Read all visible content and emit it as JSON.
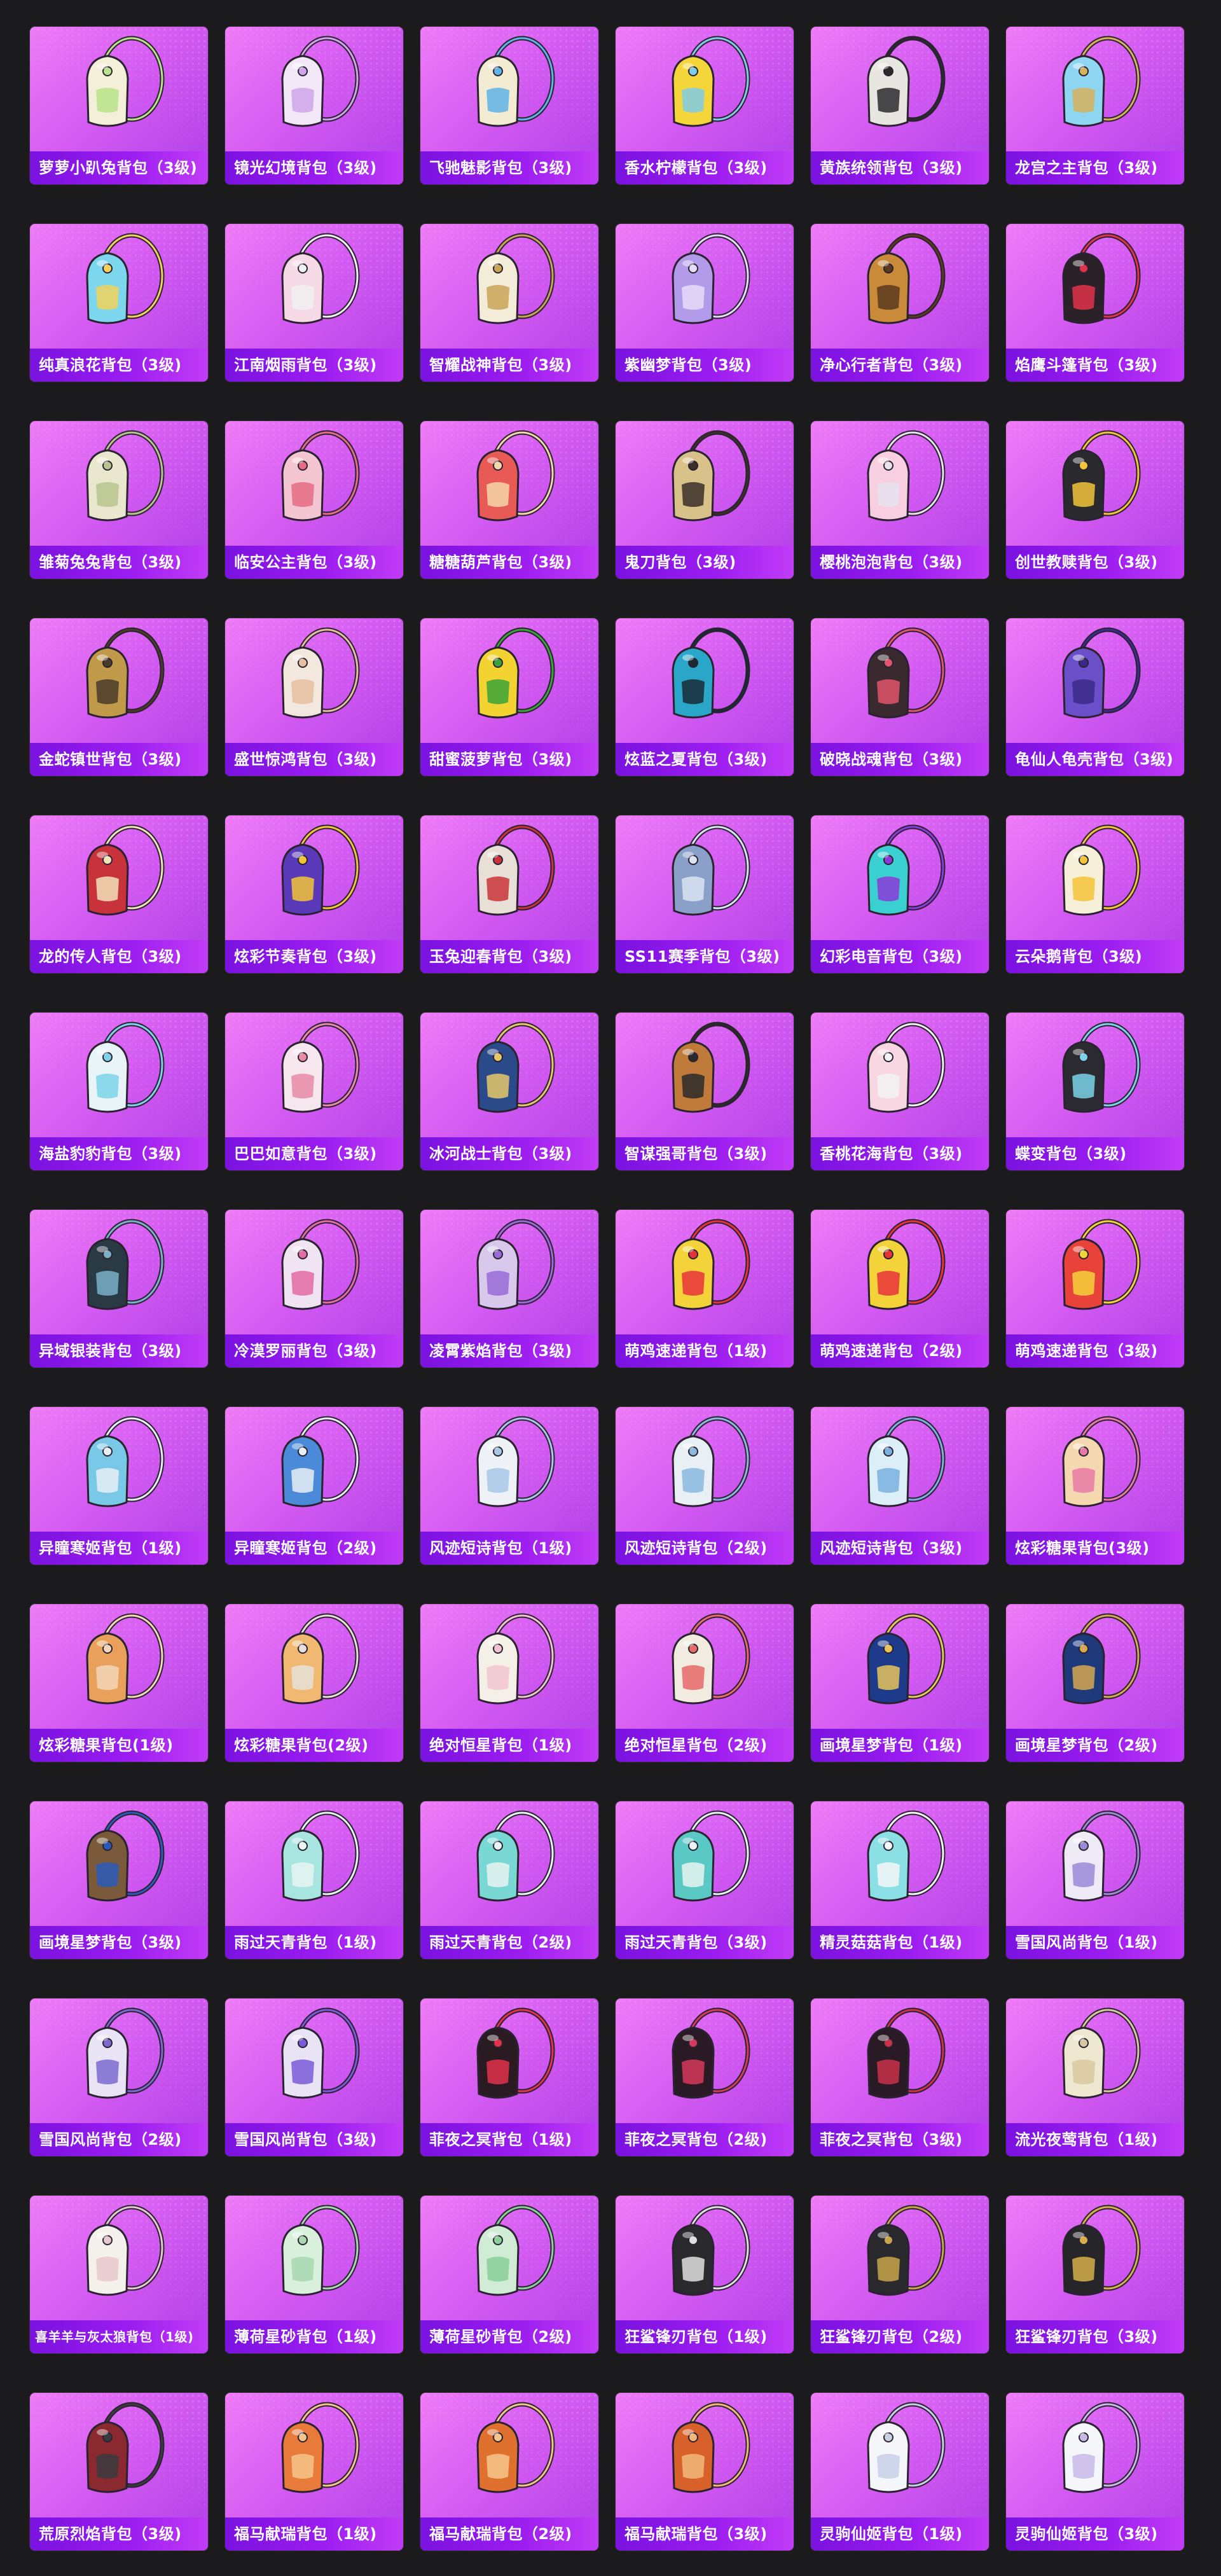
{
  "items": [
    {
      "label": "萝萝小趴兔背包（3级)",
      "color": "#f4efd8",
      "accent": "#b9e28a",
      "icon": "bunny-backpack-icon"
    },
    {
      "label": "镜光幻境背包（3级)",
      "color": "#f2e7f6",
      "accent": "#cfa4ea",
      "icon": "butterfly-backpack-icon"
    },
    {
      "label": "飞驰魅影背包（3级)",
      "color": "#f3ecd2",
      "accent": "#5fb3e8",
      "icon": "helmet-backpack-icon"
    },
    {
      "label": "香水柠檬背包（3级)",
      "color": "#f5d63a",
      "accent": "#7fcbe8",
      "icon": "lemon-backpack-icon"
    },
    {
      "label": "黄族统领背包（3级)",
      "color": "#e8e6e0",
      "accent": "#2a2a2e",
      "icon": "armor-backpack-icon"
    },
    {
      "label": "龙宫之主背包（3级)",
      "color": "#8fd6f2",
      "accent": "#d6b25a",
      "icon": "dragon-backpack-icon"
    },
    {
      "label": "纯真浪花背包（3级)",
      "color": "#7cd7ee",
      "accent": "#f2d25a",
      "icon": "wave-backpack-icon"
    },
    {
      "label": "江南烟雨背包（3级)",
      "color": "#f6dbe6",
      "accent": "#f1f1f1",
      "icon": "flower-backpack-icon"
    },
    {
      "label": "智耀战神背包（3级)",
      "color": "#f3ecd8",
      "accent": "#c8a457",
      "icon": "wing-backpack-icon"
    },
    {
      "label": "紫幽梦背包（3级)",
      "color": "#b29be8",
      "accent": "#e6dcfa",
      "icon": "dream-backpack-icon"
    },
    {
      "label": "净心行者背包（3级)",
      "color": "#c98a3a",
      "accent": "#5a3a1e",
      "icon": "gourd-backpack-icon"
    },
    {
      "label": "焰鹰斗篷背包（3级)",
      "color": "#2a2228",
      "accent": "#e0334a",
      "icon": "hawk-backpack-icon"
    },
    {
      "label": "雏菊兔兔背包（3级)",
      "color": "#e9e8cf",
      "accent": "#b7c48e",
      "icon": "daisy-backpack-icon"
    },
    {
      "label": "临安公主背包（3级)",
      "color": "#f4c6d2",
      "accent": "#e46b86",
      "icon": "princess-backpack-icon"
    },
    {
      "label": "糖糖葫芦背包（3级)",
      "color": "#e85a55",
      "accent": "#f4d7a8",
      "icon": "candy-backpack-icon"
    },
    {
      "label": "鬼刀背包（3级)",
      "color": "#d9c28a",
      "accent": "#3a2e28",
      "icon": "blade-backpack-icon"
    },
    {
      "label": "樱桃泡泡背包（3级)",
      "color": "#f8cfe0",
      "accent": "#e8e2ee",
      "icon": "bow-backpack-icon"
    },
    {
      "label": "创世教赎背包（3级)",
      "color": "#2a2a2e",
      "accent": "#f2c43a",
      "icon": "genesis-backpack-icon"
    },
    {
      "label": "金蛇镇世背包（3级)",
      "color": "#c09a4a",
      "accent": "#4a3a2a",
      "icon": "snake-backpack-icon"
    },
    {
      "label": "盛世惊鸿背包（3级)",
      "color": "#f3e8de",
      "accent": "#e6bfa0",
      "icon": "swan-backpack-icon"
    },
    {
      "label": "甜蜜菠萝背包（3级)",
      "color": "#f2d332",
      "accent": "#3aa23a",
      "icon": "pineapple-backpack-icon"
    },
    {
      "label": "炫蓝之夏背包（3级)",
      "color": "#2aa7c8",
      "accent": "#1a2a36",
      "icon": "summer-backpack-icon"
    },
    {
      "label": "破晓战魂背包（3级)",
      "color": "#3a2a30",
      "accent": "#e0556a",
      "icon": "dawn-backpack-icon"
    },
    {
      "label": "龟仙人龟壳背包（3级)",
      "color": "#6a4fc9",
      "accent": "#3c2a8a",
      "icon": "turtle-shell-icon"
    },
    {
      "label": "龙的传人背包（3级)",
      "color": "#c8323a",
      "accent": "#f2e2b8",
      "icon": "dragon-heir-backpack-icon"
    },
    {
      "label": "炫彩节奏背包（3级)",
      "color": "#5a3ab8",
      "accent": "#f3c43a",
      "icon": "rhythm-backpack-icon"
    },
    {
      "label": "玉兔迎春背包（3级)",
      "color": "#e8e0d6",
      "accent": "#c8323a",
      "icon": "jade-rabbit-backpack-icon"
    },
    {
      "label": "SS11赛季背包（3级)",
      "color": "#8aa0c8",
      "accent": "#d9e4f2",
      "icon": "season-backpack-icon"
    },
    {
      "label": "幻彩电音背包（3级)",
      "color": "#3ad0d2",
      "accent": "#8a3ad8",
      "icon": "disc-backpack-icon"
    },
    {
      "label": "云朵鹅背包（3级)",
      "color": "#f6f0d8",
      "accent": "#f5c33a",
      "icon": "cloud-goose-backpack-icon"
    },
    {
      "label": "海盐豹豹背包（3级)",
      "color": "#e8f4f8",
      "accent": "#7ad3e8",
      "icon": "seal-backpack-icon"
    },
    {
      "label": "巴巴如意背包（3级)",
      "color": "#f6e6ee",
      "accent": "#e88aa6",
      "icon": "ruyi-backpack-icon"
    },
    {
      "label": "冰河战士背包（3级)",
      "color": "#2a4a8a",
      "accent": "#e6c86a",
      "icon": "glacier-backpack-icon"
    },
    {
      "label": "智谋强哥背包（3级)",
      "color": "#c07a3a",
      "accent": "#2a2a2a",
      "icon": "bear-backpack-icon"
    },
    {
      "label": "香桃花海背包（3级)",
      "color": "#f8d6e2",
      "accent": "#f2f2f2",
      "icon": "peach-backpack-icon"
    },
    {
      "label": "蝶变背包（3级)",
      "color": "#2a2a30",
      "accent": "#7ad3e8",
      "icon": "butterfly-dark-backpack-icon"
    },
    {
      "label": "异域银装背包（3级)",
      "color": "#2a3a44",
      "accent": "#7ab0c8",
      "icon": "exotic-backpack-icon"
    },
    {
      "label": "冷漠罗丽背包（3级)",
      "color": "#f0e4f2",
      "accent": "#e46ba6",
      "icon": "lolita-backpack-icon"
    },
    {
      "label": "凌霄紫焰背包（3级)",
      "color": "#d8c8ec",
      "accent": "#9a6ad8",
      "icon": "flame-backpack-icon"
    },
    {
      "label": "萌鸡速递背包（1级)",
      "color": "#f4d23a",
      "accent": "#e8323a",
      "icon": "chick-backpack-icon"
    },
    {
      "label": "萌鸡速递背包（2级)",
      "color": "#f4d23a",
      "accent": "#e8323a",
      "icon": "chick-backpack-icon"
    },
    {
      "label": "萌鸡速递背包（3级)",
      "color": "#e8423a",
      "accent": "#f4d23a",
      "icon": "chick-backpack-icon"
    },
    {
      "label": "异瞳寒姬背包（1级)",
      "color": "#7ac8e8",
      "accent": "#e8eef4",
      "icon": "ice-maiden-backpack-icon"
    },
    {
      "label": "异瞳寒姬背包（2级)",
      "color": "#4a8ad8",
      "accent": "#e8eef4",
      "icon": "ice-maiden-backpack-icon"
    },
    {
      "label": "风迹短诗背包（1级)",
      "color": "#eef2f6",
      "accent": "#a8c8e8",
      "icon": "poem-backpack-icon"
    },
    {
      "label": "风迹短诗背包（2级)",
      "color": "#e8f0f6",
      "accent": "#8ab8e0",
      "icon": "poem-backpack-icon"
    },
    {
      "label": "风迹短诗背包（3级)",
      "color": "#dceef8",
      "accent": "#7ab0e0",
      "icon": "poem-backpack-icon"
    },
    {
      "label": "炫彩糖果背包(3级)",
      "color": "#f6d8b0",
      "accent": "#e87aa6",
      "icon": "donut-backpack-icon"
    },
    {
      "label": "炫彩糖果背包(1级)",
      "color": "#e8a05a",
      "accent": "#f4d6b8",
      "icon": "donut-backpack-icon"
    },
    {
      "label": "炫彩糖果背包(2级)",
      "color": "#f0b870",
      "accent": "#e8e0d8",
      "icon": "donut-backpack-icon"
    },
    {
      "label": "绝对恒星背包（1级)",
      "color": "#f4f0e8",
      "accent": "#f2c4d0",
      "icon": "drink-backpack-icon"
    },
    {
      "label": "绝对恒星背包（2级)",
      "color": "#f2ece0",
      "accent": "#e86a6a",
      "icon": "drink-backpack-icon"
    },
    {
      "label": "画境星梦背包（1级)",
      "color": "#1e3a8a",
      "accent": "#e8c45a",
      "icon": "book-backpack-icon"
    },
    {
      "label": "画境星梦背包（2级)",
      "color": "#1e3a7a",
      "accent": "#d6a850",
      "icon": "book-backpack-icon"
    },
    {
      "label": "画境星梦背包（3级)",
      "color": "#7a5a3a",
      "accent": "#2a5ab8",
      "icon": "frame-backpack-icon"
    },
    {
      "label": "雨过天青背包（1级)",
      "color": "#a8e4e0",
      "accent": "#e8f4f2",
      "icon": "celadon-backpack-icon"
    },
    {
      "label": "雨过天青背包（2级)",
      "color": "#7ad8d4",
      "accent": "#e8f4f2",
      "icon": "celadon-backpack-icon"
    },
    {
      "label": "雨过天青背包（3级)",
      "color": "#5ac8c4",
      "accent": "#e8f4f2",
      "icon": "celadon-backpack-icon"
    },
    {
      "label": "精灵菇菇背包（1级)",
      "color": "#8ae0e4",
      "accent": "#f4f6f8",
      "icon": "mushroom-backpack-icon"
    },
    {
      "label": "雪国风尚背包（1级)",
      "color": "#eeeaf6",
      "accent": "#9a8ad8",
      "icon": "snow-backpack-icon"
    },
    {
      "label": "雪国风尚背包（2级)",
      "color": "#e8e4f6",
      "accent": "#7a6ad0",
      "icon": "penguin-backpack-icon"
    },
    {
      "label": "雪国风尚背包（3级)",
      "color": "#e8e4f6",
      "accent": "#7a5ad8",
      "icon": "penguin-backpack-icon"
    },
    {
      "label": "菲夜之冥背包（1级)",
      "color": "#2a1a22",
      "accent": "#e0334a",
      "icon": "night-backpack-icon"
    },
    {
      "label": "菲夜之冥背包（2级)",
      "color": "#2a1a26",
      "accent": "#d63a5a",
      "icon": "night-backpack-icon"
    },
    {
      "label": "菲夜之冥背包（3级)",
      "color": "#2a1a26",
      "accent": "#c8324a",
      "icon": "night-backpack-icon"
    },
    {
      "label": "流光夜莺背包（1级)",
      "color": "#efe8d0",
      "accent": "#d8c8a0",
      "icon": "nightingale-backpack-icon"
    },
    {
      "label": "喜羊羊与灰太狼背包（1级)",
      "color": "#f4f0ec",
      "accent": "#e8c8d0",
      "icon": "sheep-backpack-icon",
      "small": true
    },
    {
      "label": "薄荷星砂背包（1级)",
      "color": "#d8f0dc",
      "accent": "#a8d8b0",
      "icon": "mint-backpack-icon"
    },
    {
      "label": "薄荷星砂背包（2级)",
      "color": "#d0ecd4",
      "accent": "#8ad09a",
      "icon": "mint-backpack-icon"
    },
    {
      "label": "狂鲨锋刃背包（1级)",
      "color": "#2a2a2e",
      "accent": "#e0e0e0",
      "icon": "shark-backpack-icon"
    },
    {
      "label": "狂鲨锋刃背包（2级)",
      "color": "#2a2a2e",
      "accent": "#c8a44a",
      "icon": "shark-backpack-icon"
    },
    {
      "label": "狂鲨锋刃背包（3级)",
      "color": "#26262a",
      "accent": "#d6b04a",
      "icon": "shark-backpack-icon"
    },
    {
      "label": "荒原烈焰背包（3级)",
      "color": "#8a2a30",
      "accent": "#3a3a3e",
      "icon": "wasteland-backpack-icon"
    },
    {
      "label": "福马献瑞背包（1级)",
      "color": "#e87a3a",
      "accent": "#f4c48a",
      "icon": "horse-backpack-icon"
    },
    {
      "label": "福马献瑞背包（2级)",
      "color": "#e0702e",
      "accent": "#f4c48a",
      "icon": "horse-backpack-icon"
    },
    {
      "label": "福马献瑞背包（3级)",
      "color": "#d8602a",
      "accent": "#f2b87a",
      "icon": "horse-backpack-icon"
    },
    {
      "label": "灵驹仙姬背包（1级)",
      "color": "#f4f6fa",
      "accent": "#c8d0e8",
      "icon": "mirror-backpack-icon"
    },
    {
      "label": "灵驹仙姬背包（3级)",
      "color": "#f4f6fa",
      "accent": "#c8b8e8",
      "icon": "mirror-backpack-icon"
    }
  ]
}
